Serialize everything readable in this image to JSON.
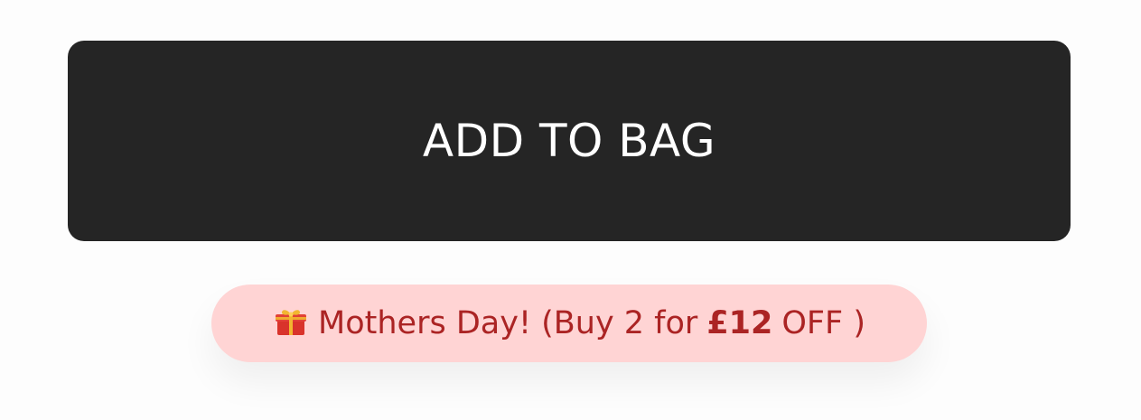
{
  "colors": {
    "button_bg": "#252525",
    "button_text": "#ffffff",
    "promo_bg": "#ffd4d4",
    "promo_text": "#ab2424",
    "gift_red": "#d9332b",
    "gift_gold": "#f2b630"
  },
  "add_to_bag": {
    "label": "ADD TO BAG"
  },
  "promo": {
    "icon": "gift-icon",
    "prefix": "Mothers Day! (Buy 2 for",
    "amount": "£12",
    "suffix": "OFF )"
  }
}
